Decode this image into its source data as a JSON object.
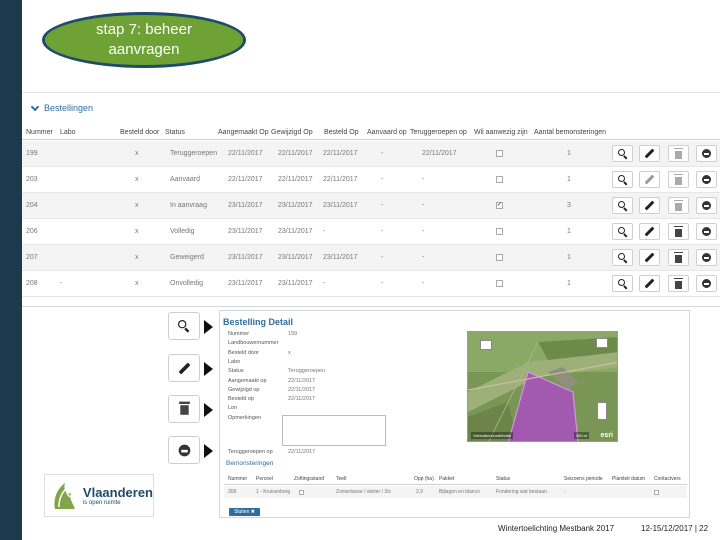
{
  "slide": {
    "title": "stap 7: beheer aanvragen",
    "footer_left": "Wintertoelichting Mestbank 2017",
    "footer_right": "12-15/12/2017 | 22"
  },
  "colors": {
    "accent_green": "#6fa234",
    "accent_blue": "#2f6d9e",
    "navy": "#1d3a4c"
  },
  "orders": {
    "section_title": "Bestellingen",
    "columns": [
      "Nummer",
      "Labo",
      "Besteld door",
      "Status",
      "Aangemaakt Op",
      "Gewijzigd Op",
      "Besteld Op",
      "Aanvaard op",
      "Teruggeroepen op",
      "Wil aanwezig zijn",
      "Aantal bemonsteringen"
    ],
    "rows": [
      {
        "nummer": "199",
        "labo": "",
        "door": "x",
        "status": "Teruggeroepen",
        "aangemaakt": "22/11/2017",
        "gewijzigd": "22/11/2017",
        "besteld": "22/11/2017",
        "aanvaard": "-",
        "terug": "22/11/2017",
        "wil": "",
        "aantal": "1"
      },
      {
        "nummer": "203",
        "labo": "",
        "door": "x",
        "status": "Aanvaard",
        "aangemaakt": "22/11/2017",
        "gewijzigd": "22/11/2017",
        "besteld": "22/11/2017",
        "aanvaard": "-",
        "terug": "-",
        "wil": "",
        "aantal": "1"
      },
      {
        "nummer": "204",
        "labo": "",
        "door": "x",
        "status": "In aanvraag",
        "aangemaakt": "23/11/2017",
        "gewijzigd": "23/11/2017",
        "besteld": "23/11/2017",
        "aanvaard": "-",
        "terug": "-",
        "wil": "✓",
        "aantal": "3"
      },
      {
        "nummer": "206",
        "labo": "",
        "door": "x",
        "status": "Volledig",
        "aangemaakt": "23/11/2017",
        "gewijzigd": "23/11/2017",
        "besteld": "-",
        "aanvaard": "-",
        "terug": "-",
        "wil": "",
        "aantal": "1"
      },
      {
        "nummer": "207",
        "labo": "",
        "door": "x",
        "status": "Geweigerd",
        "aangemaakt": "23/11/2017",
        "gewijzigd": "23/11/2017",
        "besteld": "23/11/2017",
        "aanvaard": "-",
        "terug": "-",
        "wil": "",
        "aantal": "1"
      },
      {
        "nummer": "208",
        "labo": "-",
        "door": "x",
        "status": "Onvolledig",
        "aangemaakt": "23/11/2017",
        "gewijzigd": "23/11/2017",
        "besteld": "-",
        "aanvaard": "-",
        "terug": "-",
        "wil": "",
        "aantal": "1"
      }
    ],
    "action_icons": [
      "search-icon",
      "pencil-icon",
      "trash-icon",
      "circle-icon"
    ]
  },
  "legend": {
    "icons": [
      "search-icon",
      "pencil-icon",
      "trash-icon",
      "circle-icon"
    ]
  },
  "detail": {
    "title": "Bestelling Detail",
    "fields": [
      {
        "label": "Nummer",
        "value": "199"
      },
      {
        "label": "Landbouwernummer",
        "value": ""
      },
      {
        "label": "Besteld door",
        "value": "x"
      },
      {
        "label": "Labo",
        "value": ""
      },
      {
        "label": "Status",
        "value": "Teruggeroepen"
      },
      {
        "label": "Aangemaakt op",
        "value": "22/11/2017"
      },
      {
        "label": "Gewijzigd op",
        "value": "22/11/2017"
      },
      {
        "label": "Besteld op",
        "value": "22/11/2017"
      },
      {
        "label": "Lon",
        "value": ""
      },
      {
        "label": "Opmerkingen",
        "value": ""
      }
    ],
    "teruggeroepen": {
      "label": "Teruggeroepen op",
      "value": "22/11/2017"
    },
    "map": {
      "attribution": "Gebruikerscontributie",
      "scale": "300 m",
      "logo": "esri"
    },
    "samples": {
      "title": "Bemonsteringen",
      "columns": [
        "Nummer",
        "Perceel",
        "Zoftingsstand",
        "Teelt",
        "Opp (ha)",
        "Pakket",
        "Status",
        "Seizoens periode",
        "Planiteit datum",
        "Contactvers"
      ],
      "row": [
        "358",
        "1 - Kruisenberg",
        "",
        "Zomertarwe / winter / 3/x",
        "2,9",
        "Bijlagen en blanco",
        "Fondering wat bestaan",
        "-",
        "",
        ""
      ],
      "button": "Sluiten ✖"
    }
  },
  "logo": {
    "name": "Vlaanderen",
    "tagline": "is open ruimte"
  }
}
